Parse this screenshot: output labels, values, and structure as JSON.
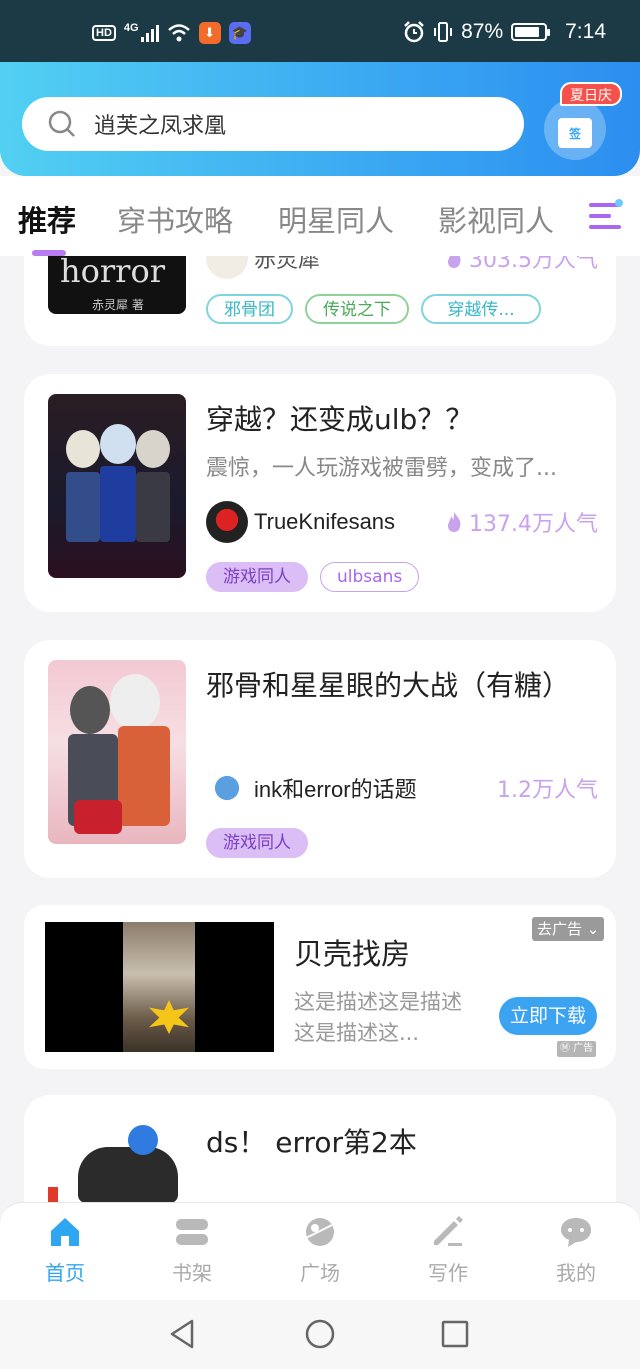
{
  "status_bar": {
    "left_badge": "HD",
    "network": "4G",
    "battery": "87%",
    "battery_level": 0.87,
    "time": "7:14"
  },
  "search": {
    "placeholder": "逍芙之凤求凰"
  },
  "checkin": {
    "badge": "夏日庆",
    "label": "签"
  },
  "tabs": [
    {
      "label": "推荐",
      "active": true
    },
    {
      "label": "穿书攻略",
      "active": false
    },
    {
      "label": "明星同人",
      "active": false
    },
    {
      "label": "影视同人",
      "active": false
    }
  ],
  "cards": [
    {
      "cover_text": "horror",
      "cover_author": "赤灵犀 著",
      "author": "赤灵犀",
      "popularity": "303.5万人气",
      "tags": [
        "邪骨团",
        "传说之下",
        "穿越传..."
      ]
    },
    {
      "title": "穿越？还变成ulb？？",
      "description": "震惊，一人玩游戏被雷劈，变成了...",
      "author": "TrueKnifesans",
      "popularity": "137.4万人气",
      "tags": [
        "游戏同人",
        "ulbsans"
      ]
    },
    {
      "title": "邪骨和星星眼的大战（有糖）",
      "author": "ink和error的话题",
      "popularity": "1.2万人气",
      "tags": [
        "游戏同人"
      ]
    },
    {
      "title": "ds！ error第2本"
    }
  ],
  "ad": {
    "title": "贝壳找房",
    "description": "这是描述这是描述这是描述这...",
    "button": "立即下载",
    "close": "去广告",
    "mark": "广告"
  },
  "bottom_nav": [
    {
      "label": "首页",
      "icon": "home-icon",
      "active": true
    },
    {
      "label": "书架",
      "icon": "bookshelf-icon",
      "active": false
    },
    {
      "label": "广场",
      "icon": "planet-icon",
      "active": false
    },
    {
      "label": "写作",
      "icon": "pen-icon",
      "active": false
    },
    {
      "label": "我的",
      "icon": "chat-icon",
      "active": false
    }
  ],
  "colors": {
    "accent": "#2fa6f2",
    "tab_indicator": "#b97bf0",
    "popularity": "#c9a2ee"
  }
}
